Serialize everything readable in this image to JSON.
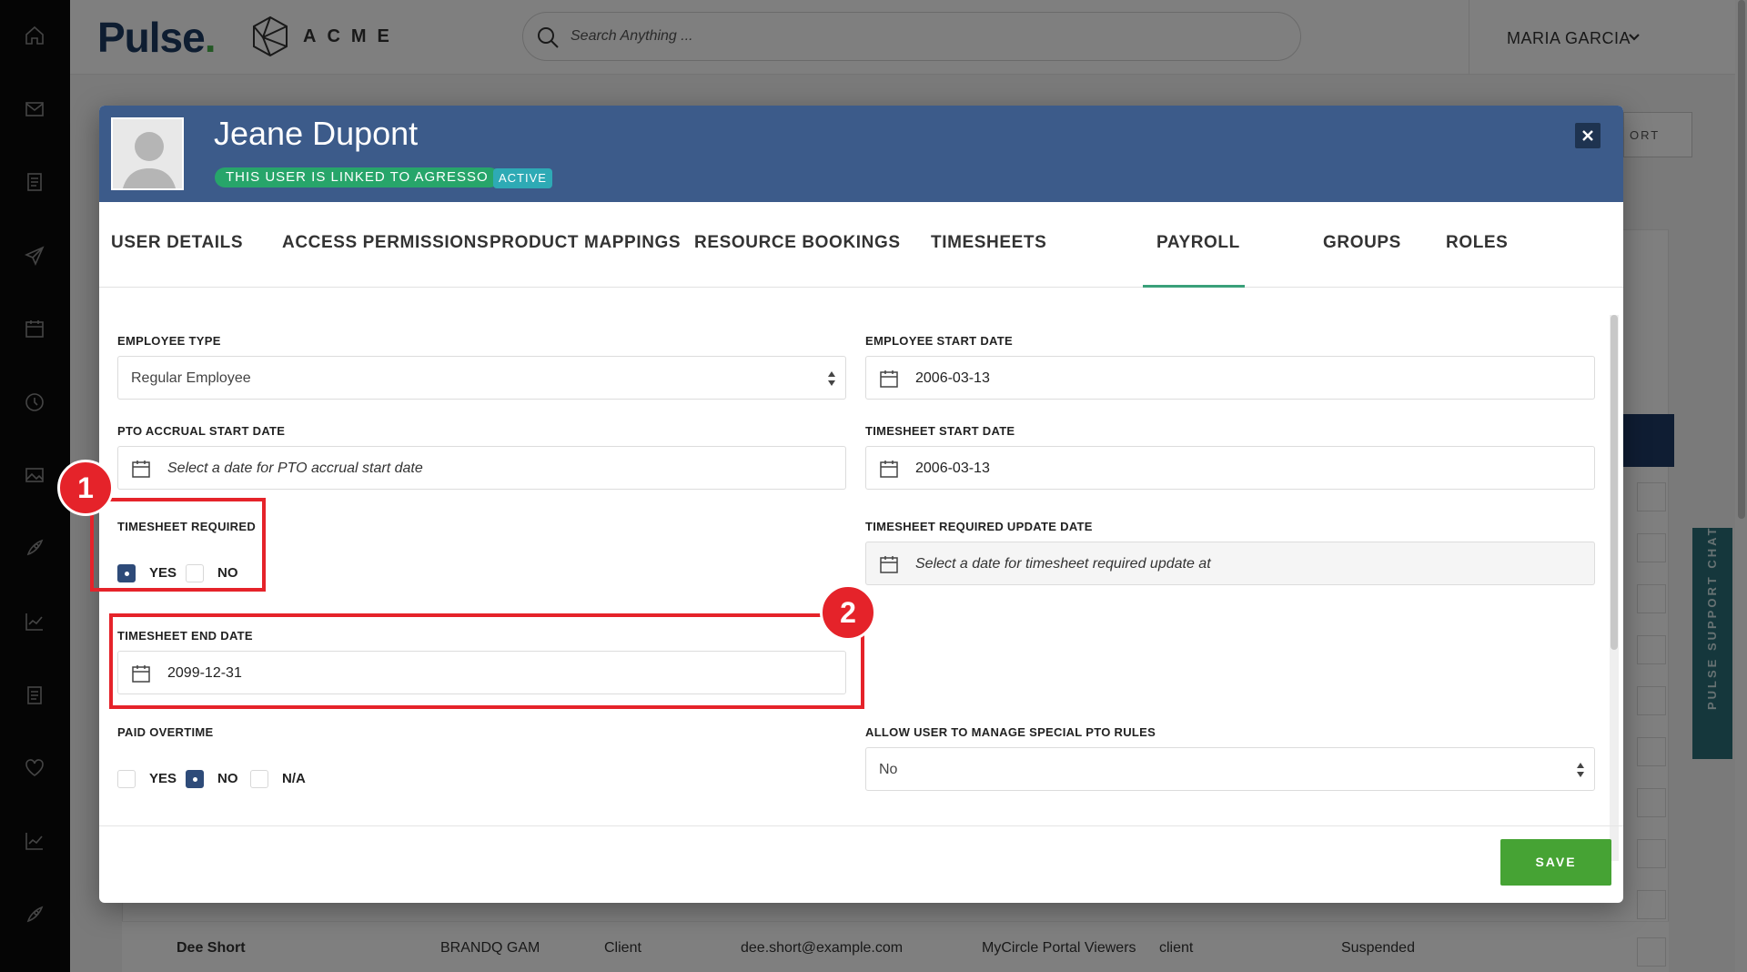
{
  "app": {
    "logo_text": "Pulse",
    "logo_dot": ".",
    "company": "ACME",
    "search_placeholder": "Search Anything ...",
    "user_name": "MARIA GARCIA",
    "sidebar_icons": [
      "home-icon",
      "mail-icon",
      "document-icon",
      "send-icon",
      "calendar-icon",
      "clock-icon",
      "image-icon",
      "rocket-icon",
      "chart-icon",
      "document-icon",
      "heart-icon",
      "chart-icon",
      "rocket-icon"
    ]
  },
  "background": {
    "button_label": "ORT",
    "support_chat": "PULSE SUPPORT CHAT",
    "rows": [
      {
        "name": "Dee Short",
        "company": "BRANDQ GAM",
        "type": "Client",
        "email": "dee.short@example.com",
        "group": "MyCircle Portal Viewers",
        "role": "client",
        "status": "Suspended"
      }
    ]
  },
  "modal": {
    "user_name": "Jeane Dupont",
    "linked_badge": "THIS USER IS LINKED TO AGRESSO",
    "status_badge": "ACTIVE",
    "tabs": [
      {
        "label": "USER DETAILS"
      },
      {
        "label": "ACCESS PERMISSIONS"
      },
      {
        "label": "PRODUCT MAPPINGS"
      },
      {
        "label": "RESOURCE BOOKINGS"
      },
      {
        "label": "TIMESHEETS"
      },
      {
        "label": "PAYROLL"
      },
      {
        "label": "GROUPS"
      },
      {
        "label": "ROLES"
      }
    ],
    "active_tab": "PAYROLL",
    "fields": {
      "employee_type": {
        "label": "EMPLOYEE TYPE",
        "value": "Regular Employee"
      },
      "employee_start_date": {
        "label": "EMPLOYEE START DATE",
        "value": "2006-03-13"
      },
      "pto_accrual_start_date": {
        "label": "PTO ACCRUAL START DATE",
        "placeholder": "Select a date for PTO accrual start date"
      },
      "timesheet_start_date": {
        "label": "TIMESHEET START DATE",
        "value": "2006-03-13"
      },
      "timesheet_required": {
        "label": "TIMESHEET REQUIRED",
        "yes": "YES",
        "no": "NO",
        "selected": "YES"
      },
      "timesheet_required_update_date": {
        "label": "TIMESHEET REQUIRED UPDATE DATE",
        "placeholder": "Select a date for timesheet required update at"
      },
      "timesheet_end_date": {
        "label": "TIMESHEET END DATE",
        "value": "2099-12-31"
      },
      "paid_overtime": {
        "label": "PAID OVERTIME",
        "yes": "YES",
        "no": "NO",
        "na": "N/A",
        "selected": "NO"
      },
      "allow_special_pto": {
        "label": "ALLOW USER TO MANAGE SPECIAL PTO RULES",
        "value": "No"
      }
    },
    "save_label": "SAVE"
  },
  "annotations": [
    "1",
    "2"
  ],
  "colors": {
    "header_blue": "#3c5b8a",
    "save_green": "#46a334",
    "linked_green": "#27a56a",
    "active_teal": "#2eaab5",
    "annotation_red": "#e5232a"
  }
}
